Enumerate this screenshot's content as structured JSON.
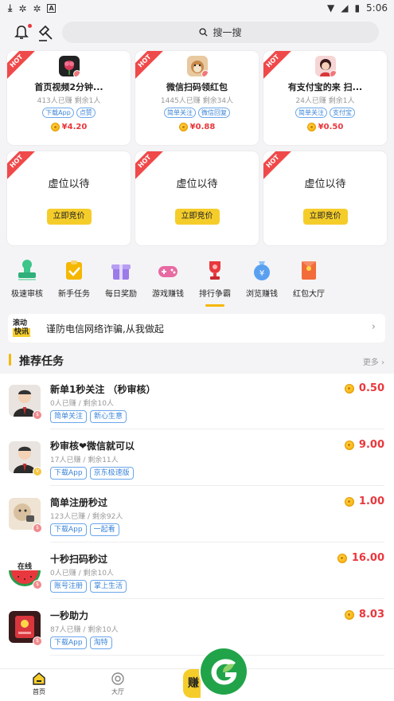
{
  "status_bar": {
    "time": "5:06",
    "left_icons": [
      "download-icon",
      "game-icon",
      "game-icon",
      "a-icon"
    ],
    "right_icons": [
      "wifi-icon",
      "signal-off-icon",
      "battery-icon"
    ]
  },
  "search": {
    "placeholder": "搜一搜"
  },
  "hot_cards": [
    {
      "hot": "HOT",
      "title": "首页视频2分钟...",
      "meta": "413人已赚  剩余1人",
      "tags": [
        "下载App",
        "点赞"
      ],
      "price": "¥4.20"
    },
    {
      "hot": "HOT",
      "title": "微信扫码领红包",
      "meta": "1445人已赚  剩余34人",
      "tags": [
        "简单关注",
        "微信回复"
      ],
      "price": "¥0.88"
    },
    {
      "hot": "HOT",
      "title": "有支付宝的来 扫...",
      "meta": "24人已赚  剩余1人",
      "tags": [
        "简单关注",
        "支付宝"
      ],
      "price": "¥0.50"
    }
  ],
  "placeholder_cards": [
    {
      "hot": "HOT",
      "title": "虚位以待",
      "button": "立即竞价"
    },
    {
      "hot": "HOT",
      "title": "虚位以待",
      "button": "立即竞价"
    },
    {
      "hot": "HOT",
      "title": "虚位以待",
      "button": "立即竞价"
    }
  ],
  "nav_items": [
    {
      "label": "极速审核",
      "icon": "stamp-icon",
      "color": "#3ec58a"
    },
    {
      "label": "新手任务",
      "icon": "task-icon",
      "color": "#f5b700"
    },
    {
      "label": "每日奖励",
      "icon": "gift-icon",
      "color": "#9a7be8"
    },
    {
      "label": "游戏赚钱",
      "icon": "gamepad-icon",
      "color": "#e86aa2"
    },
    {
      "label": "排行争霸",
      "icon": "trophy-icon",
      "color": "#e8383d"
    },
    {
      "label": "浏览赚钱",
      "icon": "money-bag-icon",
      "color": "#5aa0f0"
    },
    {
      "label": "红包大厅",
      "icon": "red-envelope-icon",
      "color": "#f26b3a"
    }
  ],
  "notice": {
    "logo_line1": "滚动",
    "logo_line2": "快讯",
    "text": "谨防电信网络诈骗,从我做起"
  },
  "section": {
    "title": "推荐任务",
    "more": "更多"
  },
  "tasks": [
    {
      "title": "新单1秒关注 （秒审核）",
      "meta": "0人已赚  /  剩余10人",
      "tags": [
        "简单关注",
        "新心生意"
      ],
      "price": "0.50"
    },
    {
      "title": "秒审核❤微信就可以",
      "meta": "17人已赚  /  剩余11人",
      "tags": [
        "下载App",
        "京东极速版"
      ],
      "price": "9.00"
    },
    {
      "title": "简单注册秒过",
      "meta": "123人已赚  /  剩余92人",
      "tags": [
        "下载App",
        "一起看"
      ],
      "price": "1.00"
    },
    {
      "title": "十秒扫码秒过",
      "meta": "0人已赚  /  剩余10人",
      "tags": [
        "账号注册",
        "掌上生活"
      ],
      "price": "16.00"
    },
    {
      "title": "一秒助力",
      "meta": "87人已赚  /  剩余10人",
      "tags": [
        "下载App",
        "淘特"
      ],
      "price": "8.03"
    }
  ],
  "tabbar": {
    "home": "首页",
    "hall": "大厅",
    "earn_peek": "赚"
  },
  "colors": {
    "accent": "#f5b700",
    "price": "#e8383d",
    "tag_blue": "#3a84d8"
  }
}
